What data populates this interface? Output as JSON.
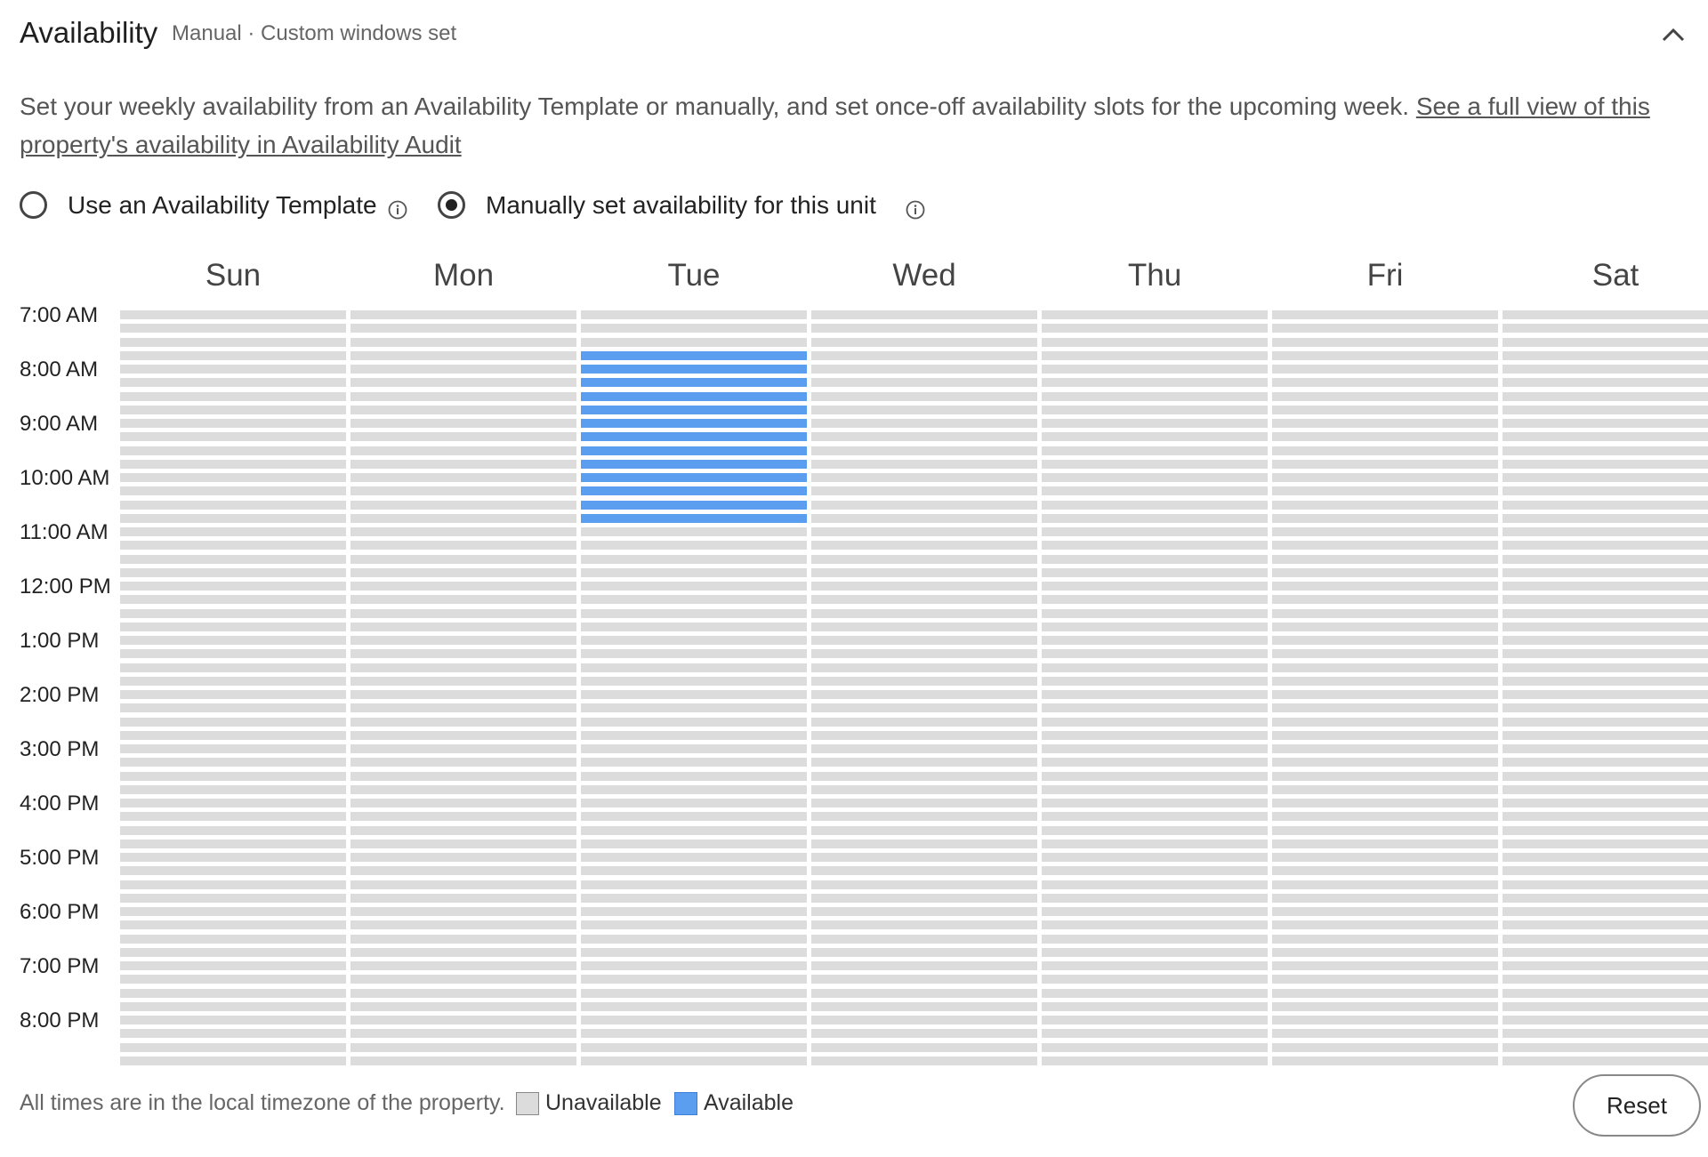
{
  "header": {
    "title": "Availability",
    "subtitle": "Manual · Custom windows set",
    "collapse_icon": "chevron-up-icon"
  },
  "description": {
    "text": "Set your weekly availability from an Availability Template or manually, and set once-off availability slots for the upcoming week. ",
    "link": "See a full view of this property's availability in Availability Audit"
  },
  "mode": {
    "options": [
      {
        "label": "Use an Availability Template",
        "selected": false
      },
      {
        "label": "Manually set availability for this unit",
        "selected": true
      }
    ],
    "info_icon": "info-circle-icon"
  },
  "schedule": {
    "days": [
      "Sun",
      "Mon",
      "Tue",
      "Wed",
      "Thu",
      "Fri",
      "Sat"
    ],
    "times": [
      "7:00 AM",
      "8:00 AM",
      "9:00 AM",
      "10:00 AM",
      "11:00 AM",
      "12:00 PM",
      "1:00 PM",
      "2:00 PM",
      "3:00 PM",
      "4:00 PM",
      "5:00 PM",
      "6:00 PM",
      "7:00 PM",
      "8:00 PM"
    ],
    "slots_per_hour": 4,
    "available": [
      {
        "day": "Tue",
        "start": "7:45 AM",
        "end": "11:00 AM"
      }
    ]
  },
  "footer": {
    "note": "All times are in the local timezone of the property.",
    "legend": [
      {
        "label": "Unavailable",
        "color": "#dcdcdc"
      },
      {
        "label": "Available",
        "color": "#5b9ef0"
      }
    ],
    "reset_label": "Reset"
  }
}
